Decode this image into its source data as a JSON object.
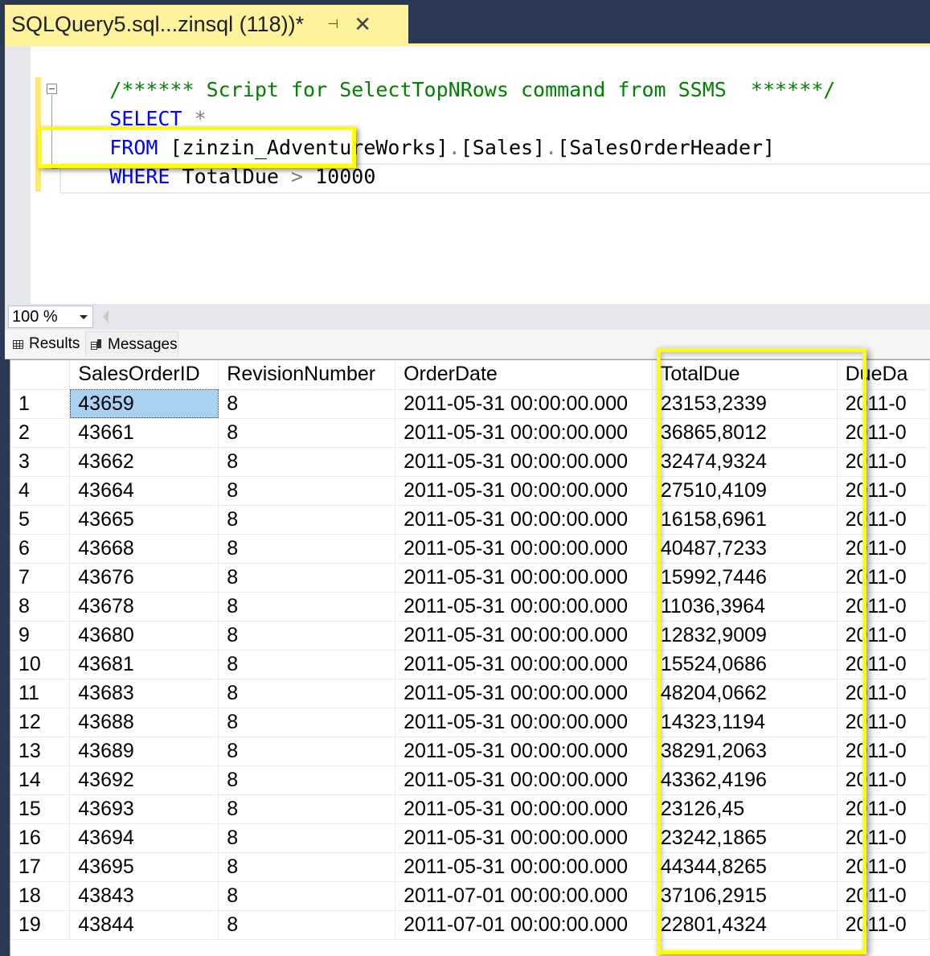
{
  "document_tab": {
    "title": "SQLQuery5.sql...zinsql (118))*",
    "pin_icon": "⊣",
    "close_icon": "✕"
  },
  "editor": {
    "comment": "/****** Script for SelectTopNRows command from SSMS  ******/",
    "line_select": {
      "keyword": "SELECT",
      "rest": " *"
    },
    "line_from": {
      "keyword": "FROM",
      "object_db": "[zinzin_AdventureWorks]",
      "dot1": ".",
      "object_schema": "[Sales]",
      "dot2": ".",
      "object_table": "[SalesOrderHeader]"
    },
    "line_where": {
      "keyword": "WHERE",
      "column": " TotalDue ",
      "operator": ">",
      "value": " 10000"
    }
  },
  "zoom": {
    "value": "100 %"
  },
  "results_tabs": [
    {
      "label": "Results",
      "icon": "grid-icon",
      "active": true
    },
    {
      "label": "Messages",
      "icon": "messages-icon",
      "active": false
    }
  ],
  "grid": {
    "columns": [
      "",
      "SalesOrderID",
      "RevisionNumber",
      "OrderDate",
      "TotalDue",
      "DueDa"
    ],
    "rows": [
      [
        "1",
        "43659",
        "8",
        "2011-05-31 00:00:00.000",
        "23153,2339",
        "2011-0"
      ],
      [
        "2",
        "43661",
        "8",
        "2011-05-31 00:00:00.000",
        "36865,8012",
        "2011-0"
      ],
      [
        "3",
        "43662",
        "8",
        "2011-05-31 00:00:00.000",
        "32474,9324",
        "2011-0"
      ],
      [
        "4",
        "43664",
        "8",
        "2011-05-31 00:00:00.000",
        "27510,4109",
        "2011-0"
      ],
      [
        "5",
        "43665",
        "8",
        "2011-05-31 00:00:00.000",
        "16158,6961",
        "2011-0"
      ],
      [
        "6",
        "43668",
        "8",
        "2011-05-31 00:00:00.000",
        "40487,7233",
        "2011-0"
      ],
      [
        "7",
        "43676",
        "8",
        "2011-05-31 00:00:00.000",
        "15992,7446",
        "2011-0"
      ],
      [
        "8",
        "43678",
        "8",
        "2011-05-31 00:00:00.000",
        "11036,3964",
        "2011-0"
      ],
      [
        "9",
        "43680",
        "8",
        "2011-05-31 00:00:00.000",
        "12832,9009",
        "2011-0"
      ],
      [
        "10",
        "43681",
        "8",
        "2011-05-31 00:00:00.000",
        "15524,0686",
        "2011-0"
      ],
      [
        "11",
        "43683",
        "8",
        "2011-05-31 00:00:00.000",
        "48204,0662",
        "2011-0"
      ],
      [
        "12",
        "43688",
        "8",
        "2011-05-31 00:00:00.000",
        "14323,1194",
        "2011-0"
      ],
      [
        "13",
        "43689",
        "8",
        "2011-05-31 00:00:00.000",
        "38291,2063",
        "2011-0"
      ],
      [
        "14",
        "43692",
        "8",
        "2011-05-31 00:00:00.000",
        "43362,4196",
        "2011-0"
      ],
      [
        "15",
        "43693",
        "8",
        "2011-05-31 00:00:00.000",
        "23126,45",
        "2011-0"
      ],
      [
        "16",
        "43694",
        "8",
        "2011-05-31 00:00:00.000",
        "23242,1865",
        "2011-0"
      ],
      [
        "17",
        "43695",
        "8",
        "2011-05-31 00:00:00.000",
        "44344,8265",
        "2011-0"
      ],
      [
        "18",
        "43843",
        "8",
        "2011-07-01 00:00:00.000",
        "37106,2915",
        "2011-0"
      ],
      [
        "19",
        "43844",
        "8",
        "2011-07-01 00:00:00.000",
        "22801,4324",
        "2011-0"
      ]
    ],
    "selected_cell": {
      "row": 1,
      "column": "SalesOrderID"
    }
  },
  "highlight_color": "#ffff00"
}
